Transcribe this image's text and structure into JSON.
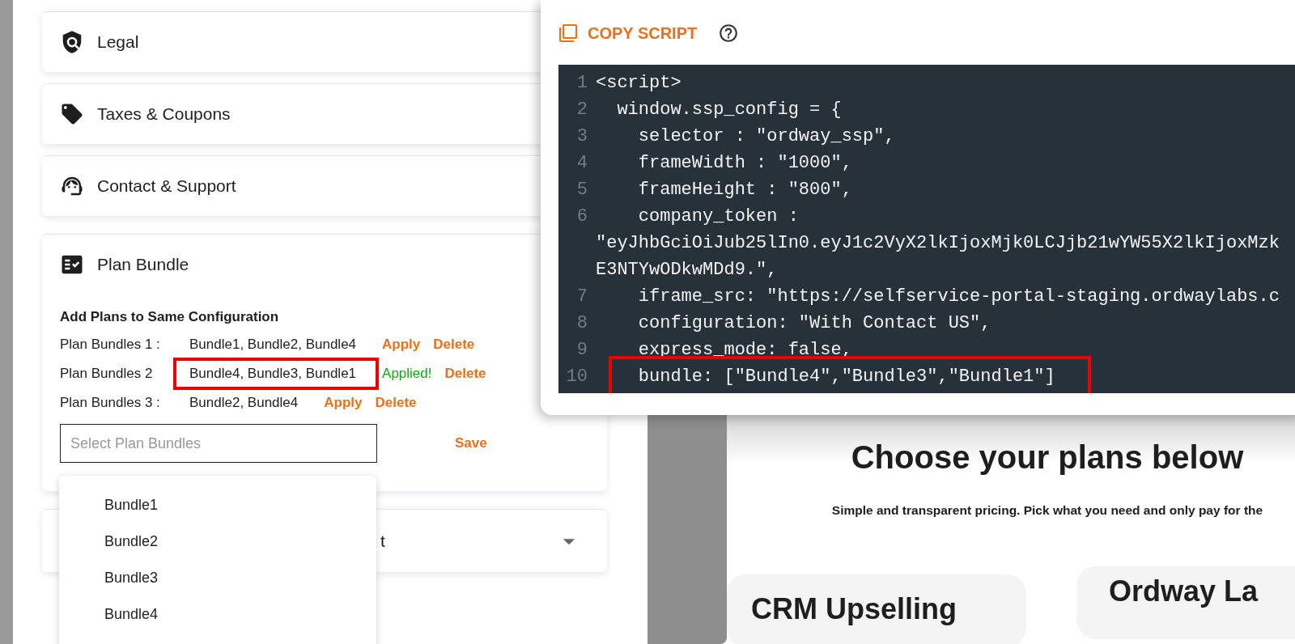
{
  "settings_sections": [
    {
      "kind": "legal",
      "label": "Legal"
    },
    {
      "kind": "tag",
      "label": "Taxes & Coupons"
    },
    {
      "kind": "support",
      "label": "Contact & Support"
    }
  ],
  "plan_bundle": {
    "title": "Plan Bundle",
    "subtitle": "Add Plans to Same Configuration",
    "rows": [
      {
        "label": "Plan Bundles 1 :",
        "bundles": "Bundle1, Bundle2, Bundle4",
        "action": "Apply",
        "applied": false,
        "delete": "Delete",
        "highlighted": false
      },
      {
        "label": "Plan Bundles 2",
        "bundles": "Bundle4, Bundle3, Bundle1",
        "action": "Applied!",
        "applied": true,
        "delete": "Delete",
        "highlighted": true
      },
      {
        "label": "Plan Bundles 3 :",
        "bundles": "Bundle2, Bundle4",
        "action": "Apply",
        "applied": false,
        "delete": "Delete",
        "highlighted": false
      }
    ],
    "select": {
      "placeholder": "Select Plan Bundles"
    },
    "save": "Save",
    "options": [
      "Bundle1",
      "Bundle2",
      "Bundle3",
      "Bundle4"
    ]
  },
  "collapsed_section": {
    "label_fragment": "t",
    "expanded": false
  },
  "copy_script": {
    "title": "COPY SCRIPT",
    "lines": [
      {
        "number": "1",
        "text": "<script>",
        "highlighted": false
      },
      {
        "number": "2",
        "text": "  window.ssp_config = {",
        "highlighted": false
      },
      {
        "number": "3",
        "text": "    selector : \"ordway_ssp\",",
        "highlighted": false
      },
      {
        "number": "4",
        "text": "    frameWidth : \"1000\",",
        "highlighted": false
      },
      {
        "number": "5",
        "text": "    frameHeight : \"800\",",
        "highlighted": false
      },
      {
        "number": "6",
        "text": "    company_token :",
        "highlighted": false
      },
      {
        "text": "\"eyJhbGciOiJub25lIn0.eyJ1c2VyX2lkIjoxMjk0LCJjb21wYW55X2lkIjoxMzk",
        "highlighted": false
      },
      {
        "text": "E3NTYwODkwMDd9.\",",
        "highlighted": false
      },
      {
        "number": "7",
        "text": "    iframe_src: \"https://selfservice-portal-staging.ordwaylabs.c",
        "highlighted": false
      },
      {
        "number": "8",
        "text": "    configuration: \"With Contact US\",",
        "highlighted": false
      },
      {
        "number": "9",
        "text": "    express_mode: false,",
        "highlighted": false
      },
      {
        "number": "10",
        "text": "    bundle: [\"Bundle4\",\"Bundle3\",\"Bundle1\"]",
        "highlighted": true
      }
    ]
  },
  "preview": {
    "heading": "Choose your plans below",
    "subtitle": "Simple and transparent pricing. Pick what you need and only pay for the",
    "plans": [
      "CRM Upselling",
      "Ordway La"
    ]
  }
}
